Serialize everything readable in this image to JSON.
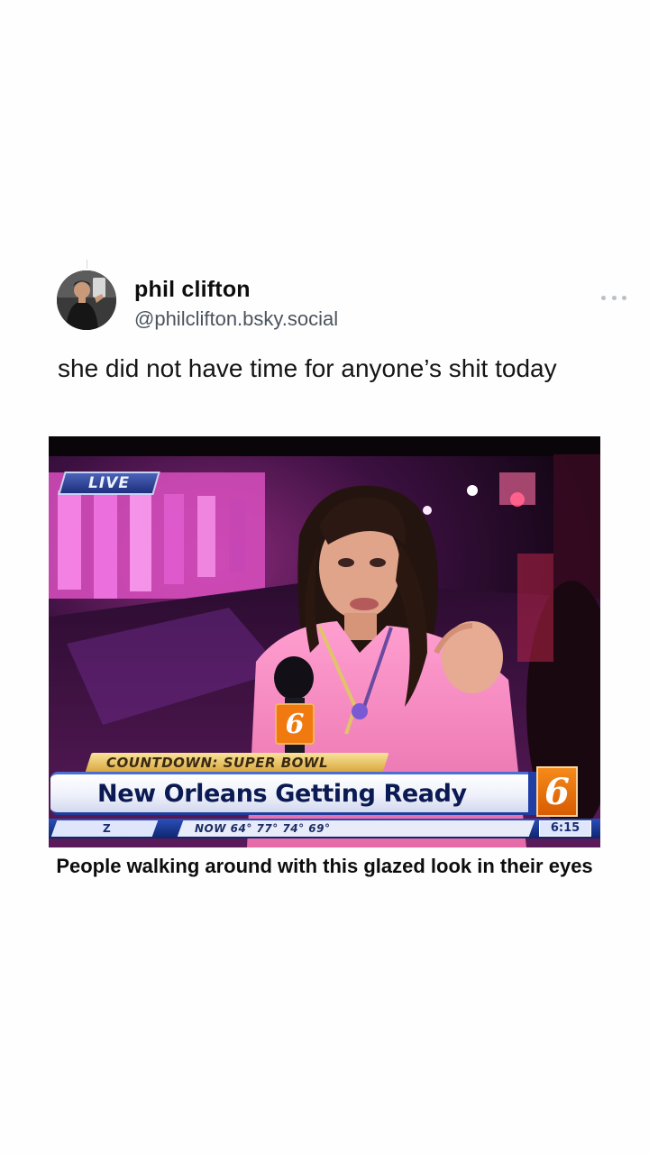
{
  "post": {
    "author_name": "phil clifton",
    "author_handle": "@philclifton.bsky.social",
    "text": "she did not have time for anyone’s shit today",
    "more_icon": "ellipsis-icon",
    "avatar_icon": "profile-photo"
  },
  "media": {
    "live_label": "LIVE",
    "mic_flag_label": "6",
    "strap_top_label": "COUNTDOWN: SUPER BOWL",
    "headline": "New Orleans Getting Ready",
    "station_logo": "6",
    "ticker_brand": "Z",
    "ticker_weather": "NOW 64°   77°   74°   69°",
    "ticker_time": "6:15",
    "caption": "People walking around with this glazed look in their eyes"
  },
  "colors": {
    "background": "#fefefe",
    "handle_text": "#4a545e",
    "headline_blue": "#0b1a52",
    "station_orange": "#f07a10"
  }
}
